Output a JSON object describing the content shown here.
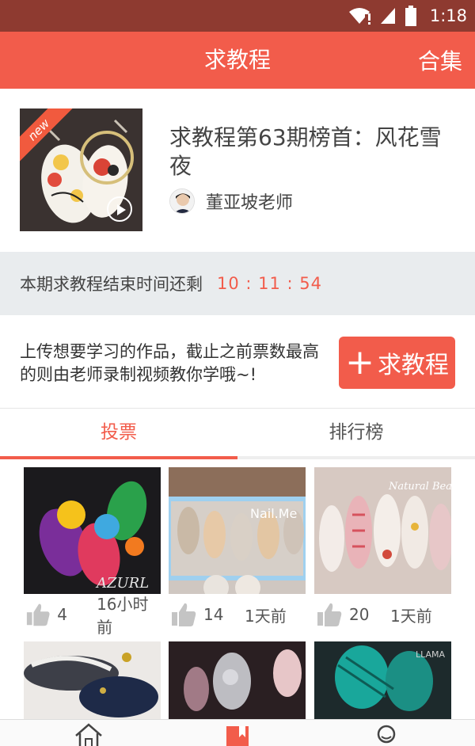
{
  "status_bar": {
    "time": "1:18"
  },
  "header": {
    "title": "求教程",
    "collection_label": "合集"
  },
  "featured": {
    "badge": "new",
    "title": "求教程第63期榜首：风花雪夜",
    "author": "董亚坡老师"
  },
  "countdown": {
    "label": "本期求教程结束时间还剩",
    "timer": "10 : 11 : 54"
  },
  "upload": {
    "description": "上传想要学习的作品，截止之前票数最高的则由老师录制视频教你学哦~!",
    "button_label": "求教程"
  },
  "tabs": {
    "vote": "投票",
    "ranking": "排行榜"
  },
  "posts": [
    {
      "likes": "4",
      "time": "16小时前",
      "watermark": "AZURL"
    },
    {
      "likes": "14",
      "time": "1天前",
      "watermark": "Nail.Me"
    },
    {
      "likes": "20",
      "time": "1天前",
      "watermark": "Natural Beauty"
    },
    {
      "likes": "",
      "time": "",
      "watermark": ""
    },
    {
      "likes": "",
      "time": "",
      "watermark": ""
    },
    {
      "likes": "",
      "time": "",
      "watermark": "LLAMA"
    }
  ],
  "colors": {
    "accent": "#f25c4b",
    "status_bar": "#8e3a30",
    "countdown_bg": "#e9ecee"
  },
  "icons": [
    "wifi-icon",
    "signal-icon",
    "battery-icon",
    "play-icon",
    "thumbs-up-icon",
    "home-icon",
    "bookmark-icon",
    "user-icon"
  ]
}
